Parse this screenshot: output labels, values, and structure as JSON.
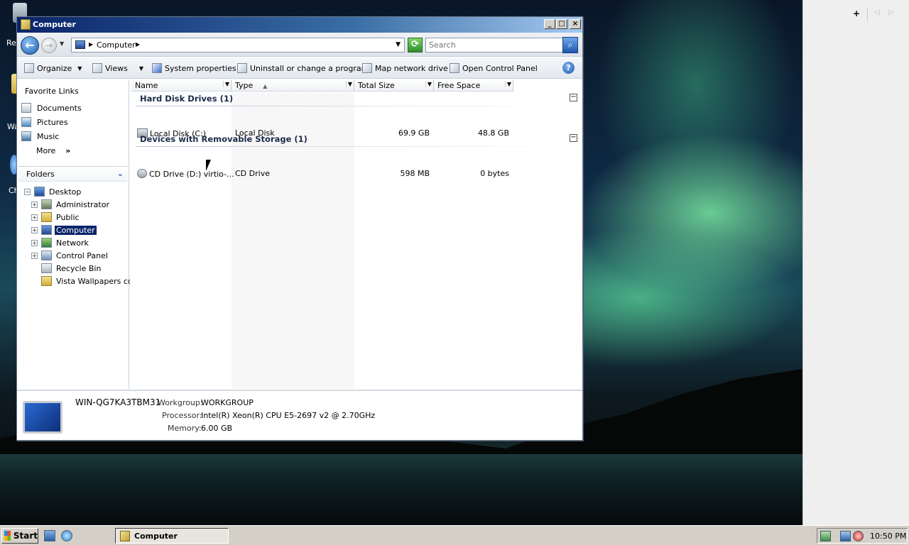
{
  "window": {
    "title": "Computer",
    "minimize": "_",
    "maximize": "□",
    "close": "×"
  },
  "address": {
    "crumb": "Computer",
    "search_placeholder": "Search"
  },
  "toolbar": {
    "organize": "Organize",
    "views": "Views",
    "system_properties": "System properties",
    "uninstall": "Uninstall or change a program",
    "map_drive": "Map network drive",
    "control_panel": "Open Control Panel",
    "help": "?"
  },
  "favorites": {
    "header": "Favorite Links",
    "items": [
      {
        "label": "Documents",
        "icon": "documents-icon"
      },
      {
        "label": "Pictures",
        "icon": "pictures-icon"
      },
      {
        "label": "Music",
        "icon": "music-icon"
      }
    ],
    "more": "More",
    "more_chevron": "»"
  },
  "folders": {
    "header": "Folders",
    "tree": [
      {
        "label": "Desktop",
        "expander": "−"
      },
      {
        "label": "Administrator",
        "expander": "+"
      },
      {
        "label": "Public",
        "expander": "+"
      },
      {
        "label": "Computer",
        "expander": "+"
      },
      {
        "label": "Network",
        "expander": "+"
      },
      {
        "label": "Control Panel",
        "expander": "+"
      },
      {
        "label": "Recycle Bin",
        "expander": ""
      },
      {
        "label": "Vista Wallpapers colle",
        "expander": ""
      }
    ]
  },
  "columns": {
    "name": "Name",
    "type": "Type",
    "total_size": "Total Size",
    "free_space": "Free Space"
  },
  "groups": [
    {
      "title": "Hard Disk Drives (1)",
      "items": [
        {
          "name": "Local Disk (C:)",
          "type": "Local Disk",
          "total": "69.9 GB",
          "free": "48.8 GB"
        }
      ]
    },
    {
      "title": "Devices with Removable Storage (1)",
      "items": [
        {
          "name": "CD Drive (D:) virtio-...",
          "type": "CD Drive",
          "total": "598 MB",
          "free": "0 bytes"
        }
      ]
    }
  ],
  "details": {
    "name": "WIN-QG7KA3TBM31",
    "workgroup_label": "Workgroup:",
    "workgroup": "WORKGROUP",
    "processor_label": "Processor:",
    "processor": "Intel(R) Xeon(R) CPU E5-2697 v2 @ 2.70GHz",
    "memory_label": "Memory:",
    "memory": "6.00 GB"
  },
  "desktop_icons": {
    "recycle_label": "Re",
    "wallpapers_label": "Wa",
    "ch_label": "Ch"
  },
  "gadget_sidebar": {
    "add": "+",
    "prev": "◁",
    "next": "▷"
  },
  "taskbar": {
    "start": "Start",
    "task": "Computer",
    "clock": "10:50 PM"
  },
  "colors": {
    "title_start": "#0a246a",
    "title_end": "#a6caf0",
    "selection": "#0a246a"
  }
}
